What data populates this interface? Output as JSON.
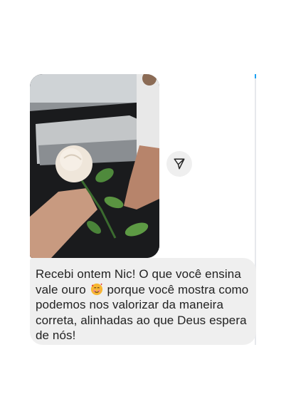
{
  "conversation": {
    "story_reply": {
      "image_description_icon": "rose-in-hand-photo"
    },
    "share_button": {
      "icon": "share-paper-plane-icon"
    },
    "message": {
      "text_part1": "Recebi ontem Nic! O que você ensina\nvale ouro ",
      "emoji": "smiling-face-with-hearts-emoji",
      "text_part2": " porque você mostra como\npodemos nos valorizar da maneira\ncorreta, alinhadas ao que Deus espera\nde nós!"
    }
  },
  "colors": {
    "bubble_bg": "#efefef",
    "text": "#222222",
    "accent": "#1da1f2"
  }
}
